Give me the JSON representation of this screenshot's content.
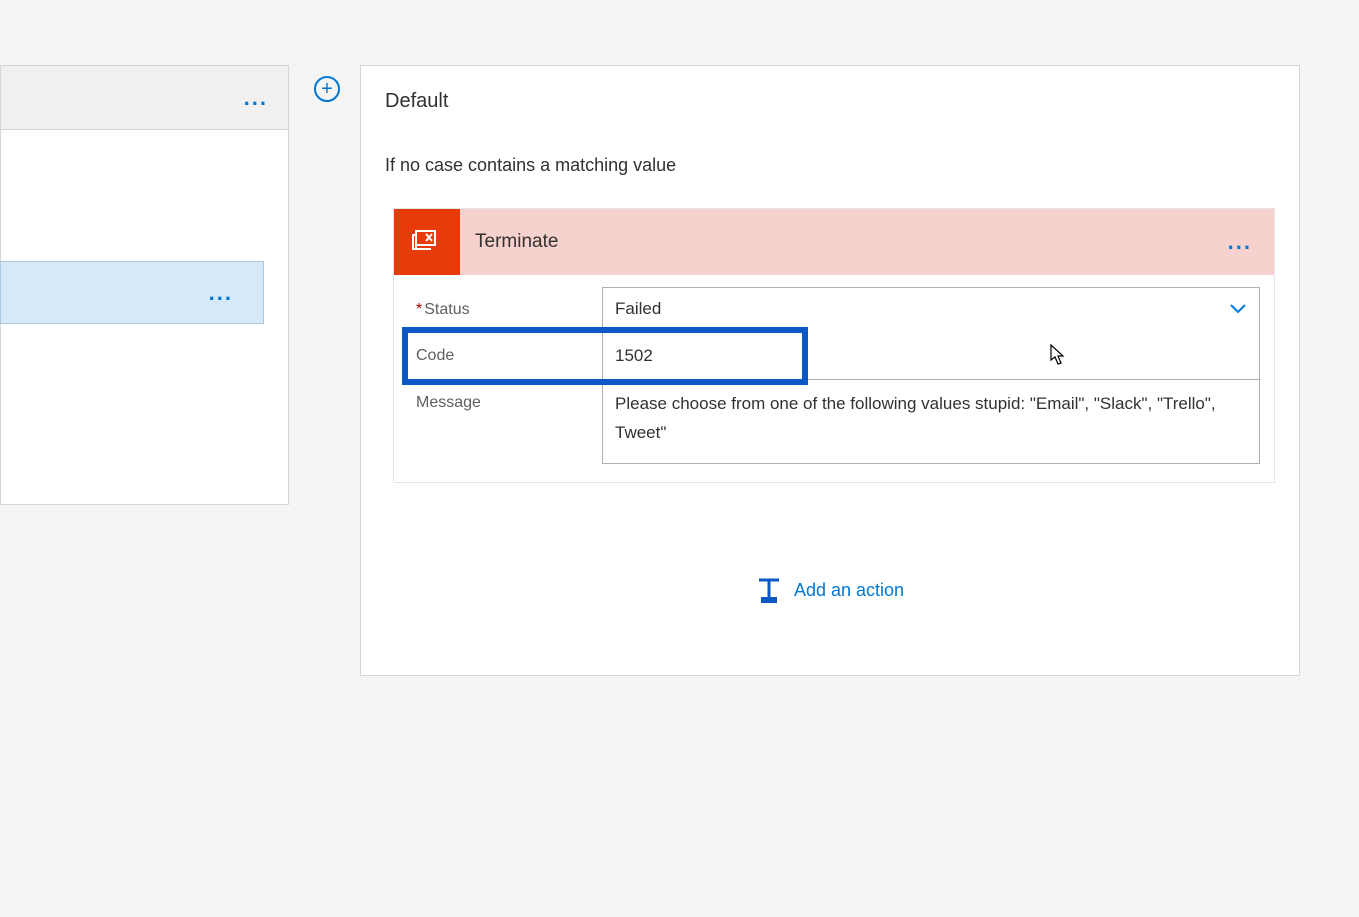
{
  "left": {
    "card1_ellipsis": "...",
    "card2_ellipsis": "..."
  },
  "plus": "+",
  "default_card": {
    "title": "Default",
    "subtitle": "If no case contains a matching value"
  },
  "terminate": {
    "title": "Terminate",
    "ellipsis": "...",
    "status_label": "Status",
    "status_value": "Failed",
    "code_label": "Code",
    "code_value": "1502",
    "message_label": "Message",
    "message_value": "Please choose from one of the following values stupid: \"Email\", \"Slack\", \"Trello\", Tweet\""
  },
  "add_action_label": "Add an action"
}
